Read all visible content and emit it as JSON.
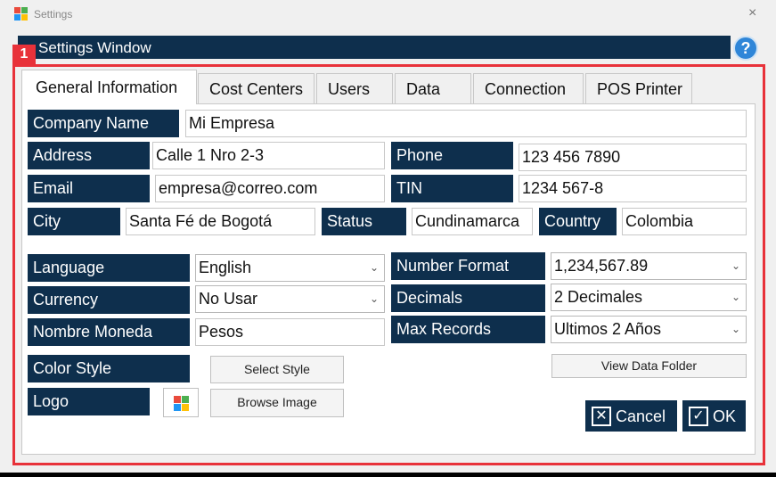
{
  "window": {
    "title": "Settings",
    "close": "×"
  },
  "header": {
    "title": "Settings Window",
    "help": "?"
  },
  "badge": "1",
  "tabs": [
    "General Information",
    "Cost Centers",
    "Users",
    "Data",
    "Connection",
    "POS Printer"
  ],
  "general": {
    "company_name": {
      "label": "Company Name",
      "value": "Mi Empresa"
    },
    "address": {
      "label": "Address",
      "value": "Calle 1 Nro 2-3"
    },
    "phone": {
      "label": "Phone",
      "value": "123 456 7890"
    },
    "email": {
      "label": "Email",
      "value": "empresa@correo.com"
    },
    "tin": {
      "label": "TIN",
      "value": "1234 567-8"
    },
    "city": {
      "label": "City",
      "value": "Santa Fé de Bogotá"
    },
    "status": {
      "label": "Status",
      "value": "Cundinamarca"
    },
    "country": {
      "label": "Country",
      "value": "Colombia"
    },
    "language": {
      "label": "Language",
      "value": "English"
    },
    "number_format": {
      "label": "Number Format",
      "value": "1,234,567.89"
    },
    "currency": {
      "label": "Currency",
      "value": "No Usar"
    },
    "decimals": {
      "label": "Decimals",
      "value": "2 Decimales"
    },
    "currency_name": {
      "label": "Nombre Moneda",
      "value": "Pesos"
    },
    "max_records": {
      "label": "Max Records",
      "value": "Ultimos 2 Años"
    },
    "color_style": {
      "label": "Color Style",
      "button": "Select Style"
    },
    "logo": {
      "label": "Logo",
      "button": "Browse Image"
    },
    "view_data_folder": "View Data Folder"
  },
  "actions": {
    "cancel": "Cancel",
    "ok": "OK"
  },
  "colors": {
    "label_bg": "#0e2f4d",
    "highlight": "#e8323a",
    "help": "#2f86d8"
  },
  "icons": [
    "app-icon",
    "close-icon",
    "help-icon",
    "chevron-down-icon",
    "cancel-x-icon",
    "ok-check-icon",
    "logo-image-icon"
  ]
}
